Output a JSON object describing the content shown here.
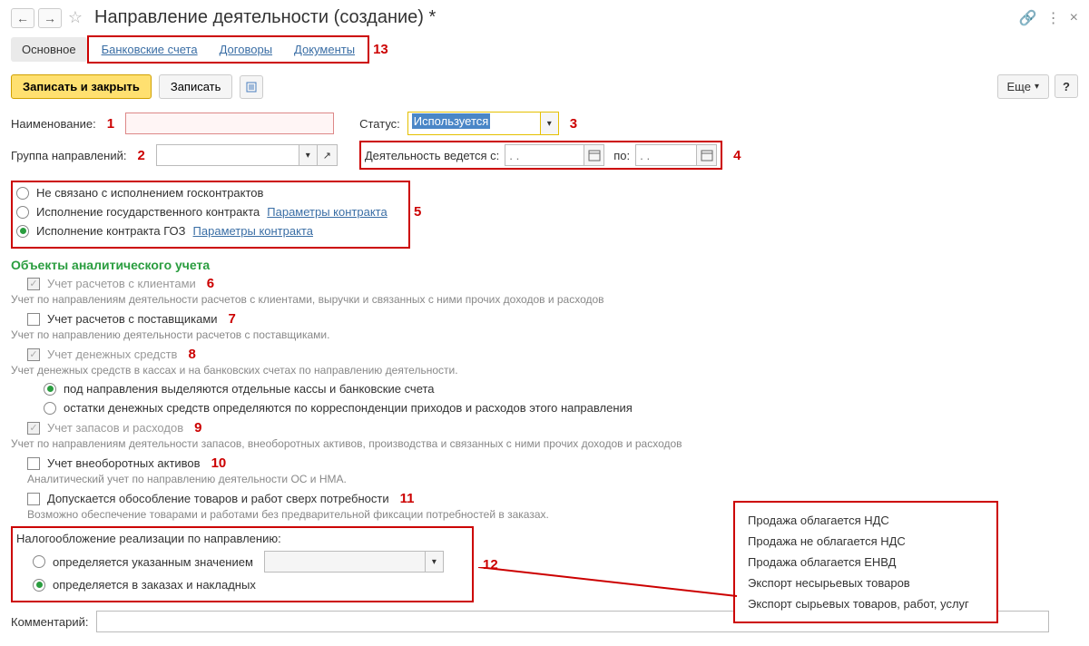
{
  "header": {
    "title": "Направление деятельности (создание) *"
  },
  "tabs": {
    "main": "Основное",
    "bank": "Банковские счета",
    "contracts": "Договоры",
    "docs": "Документы"
  },
  "annotations": {
    "n1": "1",
    "n2": "2",
    "n3": "3",
    "n4": "4",
    "n5": "5",
    "n6": "6",
    "n7": "7",
    "n8": "8",
    "n9": "9",
    "n10": "10",
    "n11": "11",
    "n12": "12",
    "n13": "13"
  },
  "actions": {
    "save_close": "Записать и закрыть",
    "save": "Записать",
    "more": "Еще",
    "help": "?"
  },
  "fields": {
    "name_label": "Наименование:",
    "status_label": "Статус:",
    "status_value": "Используется",
    "group_label": "Группа направлений:",
    "activity_from_label": "Деятельность ведется с:",
    "to_label": "по:",
    "date_placeholder": ". .",
    "comment_label": "Комментарий:"
  },
  "contract": {
    "opt1": "Не связано с исполнением госконтрактов",
    "opt2": "Исполнение государственного контракта",
    "opt3": "Исполнение контракта ГОЗ",
    "params_link": "Параметры контракта"
  },
  "analytics": {
    "title": "Объекты аналитического учета",
    "clients_check": "Учет расчетов с клиентами",
    "clients_desc": "Учет по направлениям деятельности расчетов с клиентами, выручки и связанных с ними прочих доходов и расходов",
    "suppliers_check": "Учет расчетов с поставщиками",
    "suppliers_desc": "Учет по направлению деятельности расчетов с поставщиками.",
    "cash_check": "Учет денежных средств",
    "cash_desc": "Учет денежных средств в кассах и на банковских счетах по направлению деятельности.",
    "cash_opt1": "под направления выделяются отдельные кассы и банковские счета",
    "cash_opt2": "остатки денежных средств определяются по корреспонденции приходов и расходов этого направления",
    "stock_check": "Учет запасов и расходов",
    "stock_desc": "Учет по направлениям деятельности запасов, внеоборотных активов, производства и связанных с ними прочих доходов и расходов",
    "noncurrent_check": "Учет внеоборотных активов",
    "noncurrent_desc": "Аналитический учет по направлению деятельности ОС и НМА.",
    "isolation_check": "Допускается обособление товаров и работ сверх потребности",
    "isolation_desc": "Возможно обеспечение товарами и работами без предварительной фиксации потребностей в заказах."
  },
  "tax": {
    "title": "Налогообложение реализации по направлению:",
    "opt1": "определяется указанным значением",
    "opt2": "определяется в заказах и накладных"
  },
  "popup": {
    "i1": "Продажа облагается НДС",
    "i2": "Продажа не облагается НДС",
    "i3": "Продажа облагается ЕНВД",
    "i4": "Экспорт несырьевых товаров",
    "i5": "Экспорт сырьевых товаров, работ, услуг"
  }
}
